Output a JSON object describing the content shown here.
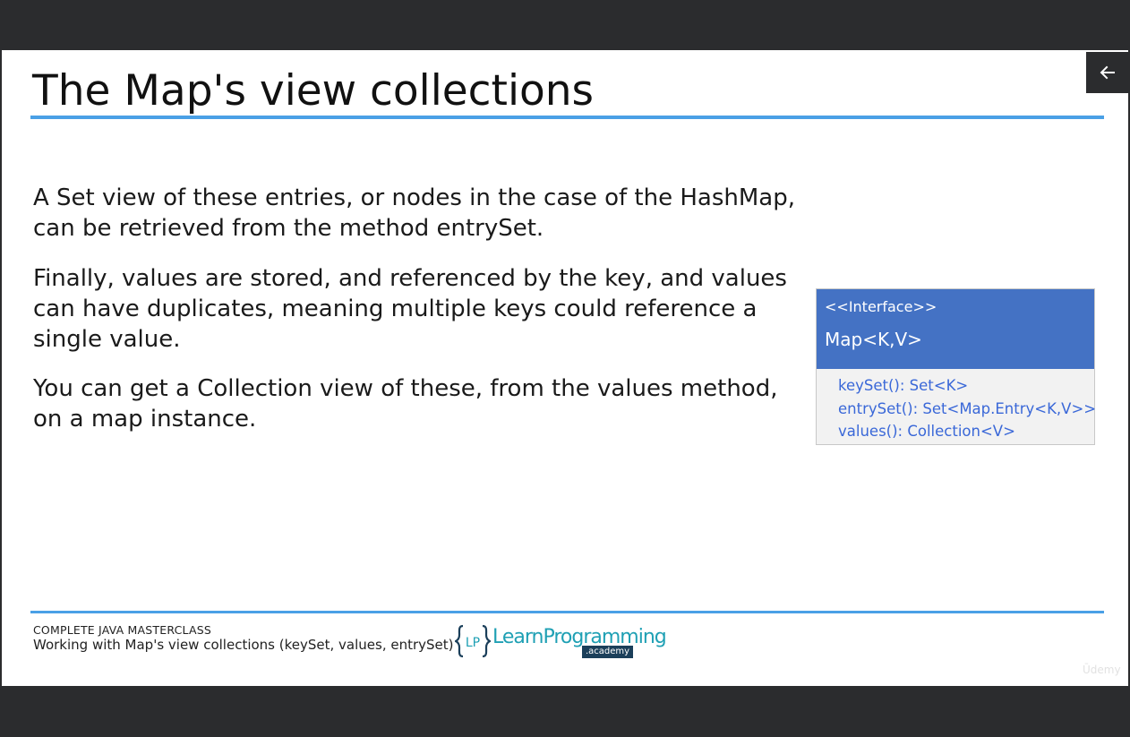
{
  "slide": {
    "title": "The Map's view collections",
    "paragraphs": [
      "A Set view of these entries, or nodes in the case of the HashMap, can be retrieved from the method entrySet.",
      "Finally, values are stored, and referenced by the key, and values can have duplicates, meaning multiple keys could reference a single value.",
      "You can get a Collection view of these, from the values method, on a map instance."
    ]
  },
  "uml": {
    "stereotype": "<<Interface>>",
    "name": "Map<K,V>",
    "methods": [
      "keySet(): Set<K>",
      "entrySet(): Set<Map.Entry<K,V>>",
      "values(): Collection<V>"
    ]
  },
  "footer": {
    "course": "COMPLETE JAVA MASTERCLASS",
    "lecture": "Working with Map's view collections (keySet, values, entrySet)",
    "logo_mark": "LP",
    "logo_text": "LearnProgramming",
    "logo_sub": ".academy"
  },
  "watermark": "Ūdemy",
  "colors": {
    "accent_rule": "#4aa0e6",
    "uml_header": "#4472c4",
    "uml_method_text": "#3a68d8",
    "frame": "#2b2c2e"
  },
  "icons": {
    "back": "arrow-left-icon"
  }
}
